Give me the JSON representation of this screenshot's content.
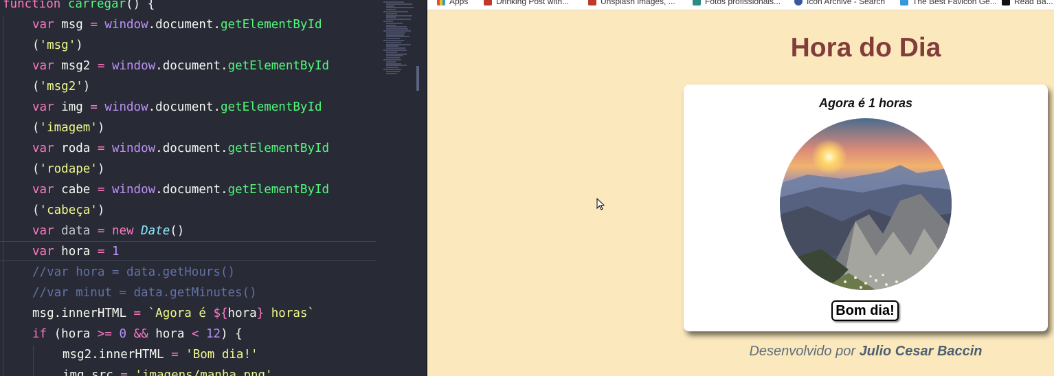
{
  "editor": {
    "code_lines": [
      "function carregar() {",
      "var msg = window.document.getElementById",
      "('msg')",
      "var msg2 = window.document.getElementById",
      "('msg2')",
      "var img = window.document.getElementById",
      "('imagem')",
      "var roda = window.document.getElementById",
      "('rodape')",
      "var cabe = window.document.getElementById",
      "('cabeça')",
      "var data = new Date()",
      "var hora = 1",
      "//var hora = data.getHours()",
      "//var minut = data.getMinutes()",
      "msg.innerHTML = `Agora é ${hora} horas`",
      "if (hora >= 0 && hora < 12) {",
      "msg2.innerHTML = 'Bom dia!'",
      "img.src = 'imagens/manha.png'"
    ],
    "theme_colors": {
      "background": "#282a36",
      "keyword": "#ff79c6",
      "function": "#50fa7b",
      "string": "#f1fa8c",
      "number": "#bd93f9",
      "comment": "#6272a4"
    }
  },
  "browser": {
    "bookmarks": [
      {
        "label": "Apps",
        "icon": "apps-grid-icon"
      },
      {
        "label": "Drinking Post with...",
        "icon": "bookmark-icon"
      },
      {
        "label": "Unsplash images, ...",
        "icon": "bookmark-icon"
      },
      {
        "label": "Fotos profissionais...",
        "icon": "bookmark-icon"
      },
      {
        "label": "Icon Archive - Search",
        "icon": "bookmark-icon"
      },
      {
        "label": "The Best Favicon Ge...",
        "icon": "bookmark-icon"
      },
      {
        "label": "Read Ba...",
        "icon": "bookmark-icon"
      }
    ],
    "page": {
      "title": "Hora do Dia",
      "message": "Agora é 1 horas",
      "greeting_button": "Bom dia!",
      "footer_prefix": "Desenvolvido por",
      "footer_author": "Julio Cesar Baccin",
      "photo_alt": "morning mountain sunrise photo"
    },
    "colors": {
      "page_background": "#fbe9bd",
      "title": "#823d3b",
      "card": "#ffffff",
      "footer_text": "#5d6d7c"
    }
  }
}
